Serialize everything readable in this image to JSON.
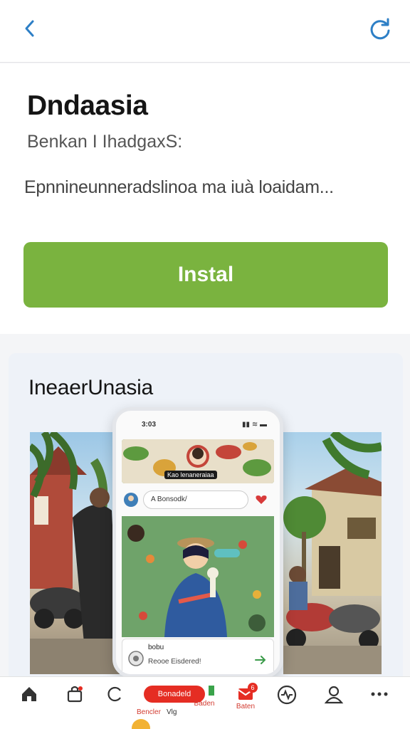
{
  "app": {
    "title": "Dndaasia",
    "subtitle": "Benkan I IhadgaxS:",
    "description": "Epnnineunneradslinoa ma iuà loaidam...",
    "install_label": "Instal"
  },
  "colors": {
    "accent_blue": "#2d7fc6",
    "install_green": "#7ab33f",
    "nav_red": "#e52d23"
  },
  "icons": {
    "back": "chevron-left-icon",
    "refresh": "refresh-icon"
  },
  "preview": {
    "title": "IneaerUnasia",
    "phone": {
      "time": "3:03",
      "status_icons": "▮▮ ≋ ▬",
      "banner_label": "Kao lenaneraiaa",
      "search_text": "A  Bonsodk/",
      "card_title": "bobu",
      "card_subtitle": "Reooe Eisdered!"
    }
  },
  "bottom_nav": {
    "pill_label": "Bonadeld",
    "items": [
      {
        "icon": "home-icon",
        "label": ""
      },
      {
        "icon": "bag-icon",
        "label": ""
      },
      {
        "icon": "chat-icon",
        "label": "Bencler"
      },
      {
        "icon": "",
        "label": "Vlg"
      },
      {
        "icon": "inbox-icon",
        "label": "Baden"
      },
      {
        "icon": "mail-icon",
        "label": "Baten",
        "badge": "6"
      },
      {
        "icon": "activity-icon",
        "label": ""
      },
      {
        "icon": "profile-icon",
        "label": ""
      },
      {
        "icon": "more-icon",
        "label": ""
      }
    ]
  }
}
